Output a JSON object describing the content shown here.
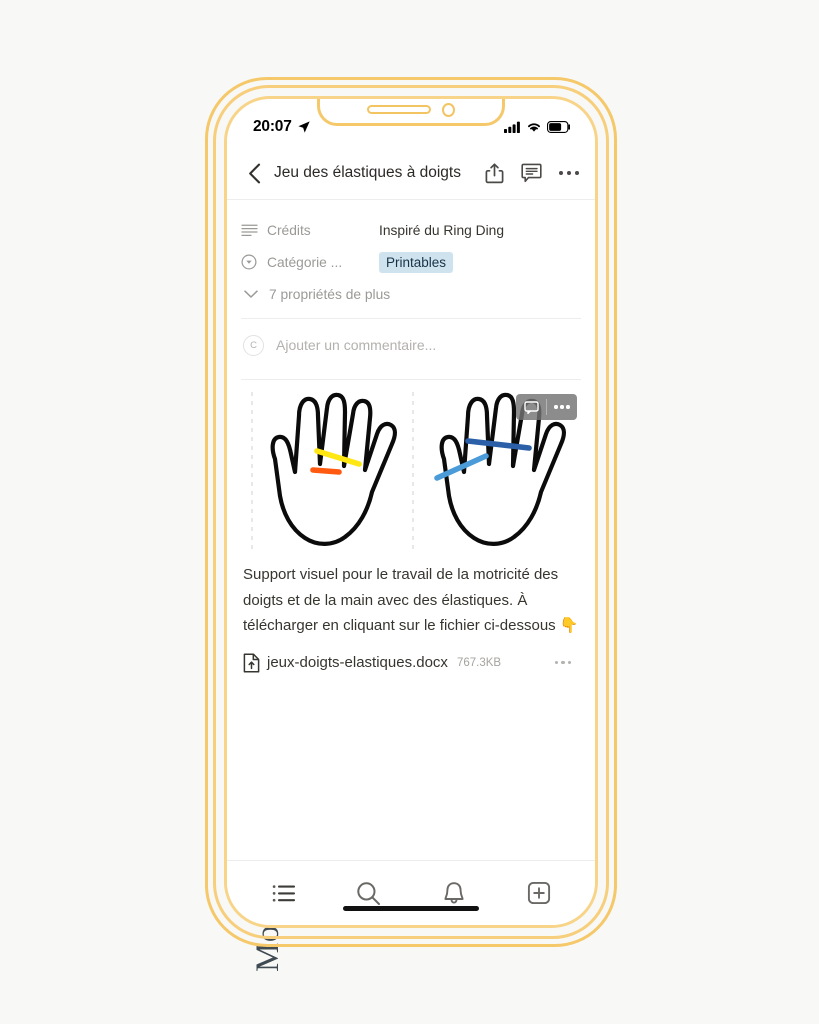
{
  "caption_vertical": "Motricité manuelle et digitale",
  "status_bar": {
    "time": "20:07",
    "location_icon": "location-arrow-icon",
    "signal_icon": "cellular-signal-icon",
    "wifi_icon": "wifi-icon",
    "battery_icon": "battery-icon"
  },
  "header": {
    "back_icon": "chevron-left-icon",
    "title": "Jeu des élastiques à doigts",
    "share_icon": "share-icon",
    "comment_icon": "comment-bubble-icon",
    "more_icon": "more-horizontal-icon"
  },
  "properties": [
    {
      "icon": "text-lines-icon",
      "label": "Crédits",
      "value": "Inspiré du Ring Ding",
      "type": "text"
    },
    {
      "icon": "circle-chevron-down-icon",
      "label": "Catégorie ...",
      "value": "Printables",
      "type": "tag"
    }
  ],
  "more_properties": {
    "icon": "chevron-down-icon",
    "label": "7 propriétés de plus"
  },
  "comment": {
    "avatar_initial": "C",
    "placeholder": "Ajouter un commentaire..."
  },
  "image_block": {
    "alt": "Deux mains ouvertes avec des élastiques entre les doigts",
    "overlay": {
      "comment_icon": "comment-bubble-icon",
      "more_icon": "more-horizontal-icon"
    },
    "elastics": [
      {
        "name": "yellow-elastic",
        "color": "#FFE713"
      },
      {
        "name": "orange-elastic",
        "color": "#FF5A10"
      },
      {
        "name": "dark-blue-elastic",
        "color": "#2B5FA8"
      },
      {
        "name": "light-blue-elastic",
        "color": "#4A9BD8"
      }
    ]
  },
  "body_text": "Support visuel pour le travail de la motricité des doigts et de la main avec des élastiques. À télécharger en cliquant sur le fichier ci-dessous 👇",
  "file": {
    "icon": "file-download-icon",
    "name": "jeux-doigts-elastiques.docx",
    "size": "767.3KB",
    "more_icon": "more-horizontal-icon"
  },
  "tab_bar": [
    {
      "icon": "list-icon",
      "name": "tab-list"
    },
    {
      "icon": "search-icon",
      "name": "tab-search"
    },
    {
      "icon": "bell-icon",
      "name": "tab-notifications"
    },
    {
      "icon": "plus-square-icon",
      "name": "tab-new"
    }
  ],
  "colors": {
    "frame": "#f5c86a",
    "background": "#f8f8f7",
    "tag_bg": "#cfe3ef",
    "tag_text": "#183347",
    "text_primary": "#37352f",
    "text_muted": "#9b9a97"
  }
}
